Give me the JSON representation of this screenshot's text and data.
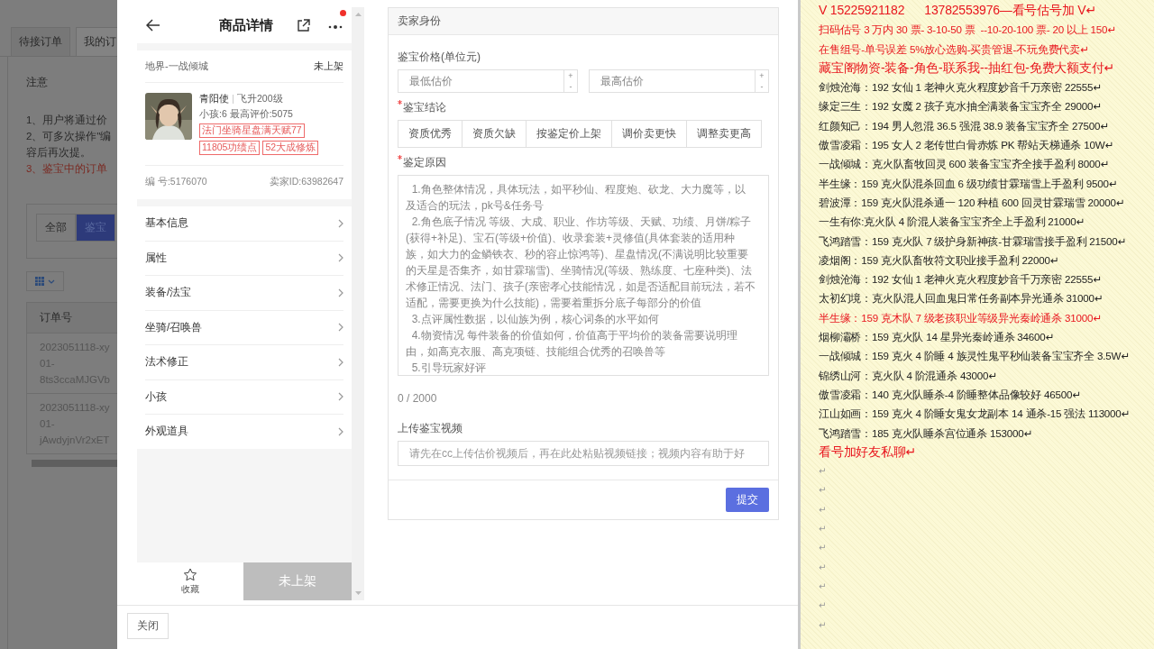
{
  "backdrop": {
    "tabs": [
      {
        "label": "待接订单",
        "selected": false
      },
      {
        "label": "我的订",
        "selected": true
      }
    ],
    "notice_title": "注意",
    "notice_lines": [
      {
        "text": "1、用户将通过价",
        "kind": "normal"
      },
      {
        "text": "2、可多次操作\"编",
        "kind": "normal"
      },
      {
        "text": "容后再次提。",
        "kind": "normal"
      },
      {
        "text": "3、鉴宝中的订单",
        "kind": "warning"
      }
    ],
    "filters": [
      {
        "label": "全部",
        "selected": false
      },
      {
        "label": "鉴宝",
        "selected": true
      }
    ],
    "table": {
      "columns": [
        "订单号"
      ],
      "rows": [
        {
          "lines": [
            "2023051118-xy",
            "01-",
            "8ts3ccaMJGVb"
          ]
        },
        {
          "lines": [
            "2023051118-xy",
            "01-",
            "jAwdyjnVr2xET"
          ]
        }
      ]
    }
  },
  "product": {
    "title": "商品详情",
    "has_notification": true,
    "server": "地界-一战倾城",
    "status": "未上架",
    "character": {
      "name": "青阳使",
      "level": "飞升200级",
      "stats": "小孩:6 最高评价:5075",
      "tags": [
        "法门坐骑星盘满天赋77",
        "11805功绩点",
        "52大成修炼"
      ]
    },
    "serial": "编 号:5176070",
    "seller_id": "卖家ID:63982647",
    "menu": [
      "基本信息",
      "属性",
      "装备/法宝",
      "坐骑/召唤兽",
      "法术修正",
      "小孩",
      "外观道具"
    ],
    "favorite_label": "收藏",
    "listing_button": {
      "label": "未上架",
      "disabled": true
    }
  },
  "form": {
    "section_title": "卖家身份",
    "price_label": "鉴宝价格(单位元)",
    "price_inputs": [
      {
        "placeholder": "最低估价",
        "step_up": "+",
        "step_down": "-"
      },
      {
        "placeholder": "最高估价",
        "step_up": "+",
        "step_down": "-"
      }
    ],
    "conclusion": {
      "label": "鉴宝结论",
      "required": true,
      "options": [
        {
          "label": "资质优秀",
          "selected": false
        },
        {
          "label": "资质欠缺",
          "selected": false
        },
        {
          "label": "按鉴定价上架",
          "selected": false
        },
        {
          "label": "调价卖更快",
          "selected": false
        },
        {
          "label": "调整卖更高",
          "selected": false
        }
      ]
    },
    "reason": {
      "label": "鉴定原因",
      "required": true,
      "placeholder": "  1.角色整体情况，具体玩法，如平秒仙、程度炮、砍龙、大力魔等，以及适合的玩法，pk号&任务号\n  2.角色底子情况 等级、大成、职业、作坊等级、天赋、功绩、月饼/粽子(获得+补足)、宝石(等级+价值)、收录套装+灵修值(具体套装的适用种族，如大力的金鳞铁衣、秒的容止惊鸿等)、星盘情况(不满说明比较重要的天星是否集齐，如甘霖瑞雪)、坐骑情况(等级、熟练度、七座种类)、法术修正情况、法门、孩子(亲密孝心技能情况，如是否适配目前玩法，若不适配，需要更换为什么技能)，需要着重拆分底子每部分的价值\n  3.点评属性数据，以仙族为例，核心词条的水平如何\n  4.物资情况 每件装备的价值如何，价值高于平均价的装备需要说明理由，如高克衣服、高克项链、技能组合优秀的召唤兽等\n  5.引导玩家好评"
    },
    "counter": "0 / 2000",
    "video": {
      "label": "上传鉴宝视频",
      "placeholder": "请先在cc上传估价视频后，再在此处粘贴视频链接；视频内容有助于好"
    },
    "submit": "提交"
  },
  "close_button": "关闭",
  "document": {
    "lines": [
      {
        "kind": "red_large",
        "text": "V 15225921182      13782553976—看号估号加 V↵"
      },
      {
        "kind": "red",
        "text": "扫码估号 3 万内 30 票- 3-10-50 票  --10-20-100 票- 20 以上 150↵"
      },
      {
        "kind": "red",
        "text": "在售组号-单号误差 5%放心选购-买贵管退-不玩免费代卖↵"
      },
      {
        "kind": "red_large",
        "text": "藏宝阁物资-装备-角色-联系我--抽红包-免费大额支付↵"
      },
      {
        "kind": "normal",
        "text": "剑烛沧海：192 女仙 1 老神火克火程度妙音千万亲密 22555↵"
      },
      {
        "kind": "normal",
        "text": "缘定三生：192 女魔 2 孩子克水抽全满装备宝宝齐全 29000↵"
      },
      {
        "kind": "normal",
        "text": "红颜知己：194 男人忽混 36.5 强混 38.9 装备宝宝齐全 27500↵"
      },
      {
        "kind": "normal",
        "text": "傲雪凌霜：195 女人 2 老传世白骨赤炼 PK 帮站天梯通杀 10W↵"
      },
      {
        "kind": "normal",
        "text": "一战倾城：克火队畜牧回灵 600 装备宝宝齐全接手盈利 8000↵"
      },
      {
        "kind": "normal",
        "text": "半生缘：159 克火队混杀回血 6 级功绩甘霖瑞雪上手盈利 9500↵"
      },
      {
        "kind": "normal",
        "text": "碧波潭：159 克火队混杀通一 120 种植 600 回灵甘霖瑞雪 20000↵"
      },
      {
        "kind": "normal",
        "text": "一生有你:克火队 4 阶混人装备宝宝齐全上手盈利 21000↵"
      },
      {
        "kind": "normal",
        "text": "飞鸿踏雪：159 克火队 7 级护身新神孩-甘霖瑞雪接手盈利 21500↵"
      },
      {
        "kind": "normal",
        "text": "凌烟阁：159 克火队畜牧符文职业接手盈利 22000↵"
      },
      {
        "kind": "normal",
        "text": "剑烛沧海：192 女仙 1 老神火克火程度妙音千万亲密 22555↵"
      },
      {
        "kind": "normal",
        "text": "太初幻境：克火队混人回血鬼日常任务副本异光通杀 31000↵"
      },
      {
        "kind": "red",
        "text": "半生缘：159 克木队 7 级老孩职业等级异光秦岭通杀 31000↵"
      },
      {
        "kind": "normal",
        "text": "烟柳灞桥：159 克火队 14 星异光秦岭通杀 34600↵"
      },
      {
        "kind": "normal",
        "text": "一战倾城：159 克火 4 阶睡 4 族灵性鬼平秒仙装备宝宝齐全 3.5W↵"
      },
      {
        "kind": "normal",
        "text": "锦绣山河：克火队 4 阶混通杀 43000↵"
      },
      {
        "kind": "normal",
        "text": "傲雪凌霜：140 克火队睡杀-4 阶睡整体品像较好 46500↵"
      },
      {
        "kind": "normal",
        "text": "江山如画：159 克火 4 阶睡女鬼女龙副本 14 通杀-15 强法 113000↵"
      },
      {
        "kind": "normal",
        "text": "飞鸿踏雪：185 克火队睡杀宫位通杀 153000↵"
      },
      {
        "kind": "red_large",
        "text": "看号加好友私聊↵"
      },
      {
        "kind": "mark",
        "text": "↵"
      },
      {
        "kind": "mark",
        "text": "↵"
      },
      {
        "kind": "mark",
        "text": "↵"
      },
      {
        "kind": "mark",
        "text": "↵"
      },
      {
        "kind": "mark",
        "text": "↵"
      },
      {
        "kind": "mark",
        "text": "↵"
      },
      {
        "kind": "mark",
        "text": "↵"
      },
      {
        "kind": "mark",
        "text": "↵"
      },
      {
        "kind": "mark",
        "text": "↵"
      }
    ]
  }
}
